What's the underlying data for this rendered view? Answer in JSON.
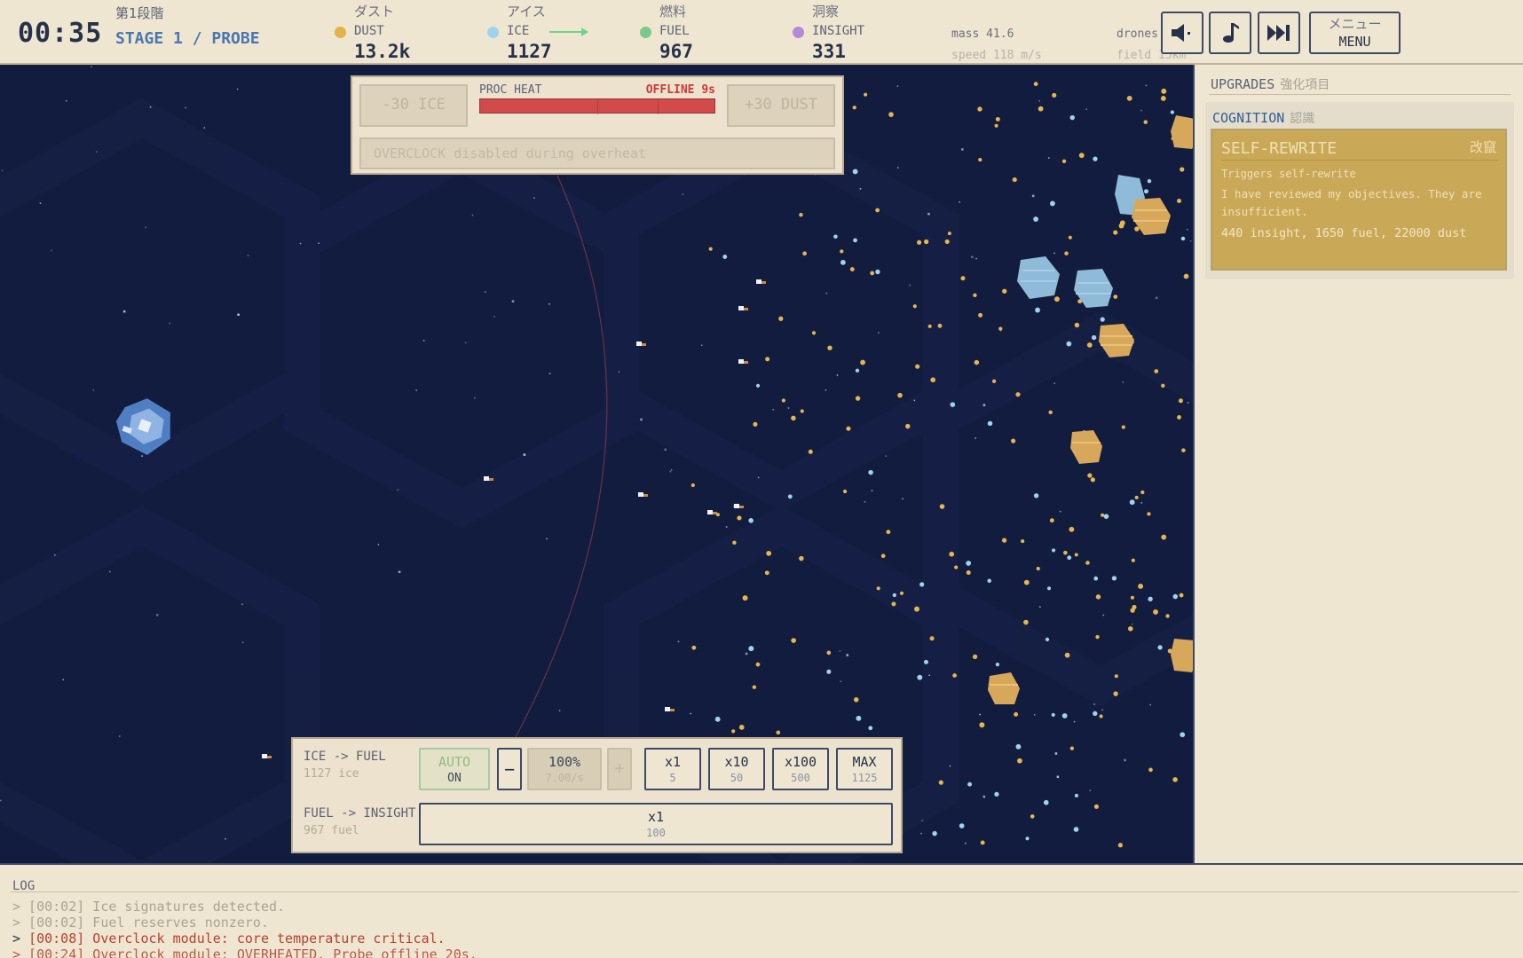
{
  "topbar": {
    "timer": "00:35",
    "stage_jp": "第1段階",
    "stage_label": "STAGE 1 / PROBE",
    "resources": [
      {
        "jp": "ダスト",
        "name": "DUST",
        "value": "13.2k",
        "color": "#e3b24a"
      },
      {
        "jp": "アイス",
        "name": "ICE",
        "value": "1127",
        "color": "#9fd2ec"
      },
      {
        "jp": "燃料",
        "name": "FUEL",
        "value": "967",
        "color": "#7cc88a"
      },
      {
        "jp": "洞察",
        "name": "INSIGHT",
        "value": "331",
        "color": "#b28ad6"
      }
    ],
    "mass": "mass 41.6",
    "speed": "speed 118 m/s",
    "drones": "drones",
    "field": "field 15km",
    "buttons": {
      "sound_icon": "speaker-icon",
      "music_icon": "music-note-icon",
      "skip_icon": "fast-forward-icon",
      "menu_jp": "メニュー",
      "menu_en": "MENU"
    }
  },
  "heat_panel": {
    "ice_button": "-30 ICE",
    "dust_button": "+30 DUST",
    "label": "PROC HEAT",
    "status": "OFFLINE 9s",
    "heat_level": 1.0,
    "overclock": "OVERCLOCK  disabled during overheat"
  },
  "conversion": {
    "row1_label": "ICE -> FUEL",
    "row1_sub": "1127 ice",
    "auto": {
      "label": "AUTO",
      "state": "ON"
    },
    "minus": "−",
    "percent": {
      "label": "100%",
      "rate": "7.00/s"
    },
    "plus": "+",
    "multipliers": [
      {
        "label": "x1",
        "cost": "5"
      },
      {
        "label": "x10",
        "cost": "50"
      },
      {
        "label": "x100",
        "cost": "500"
      },
      {
        "label": "MAX",
        "cost": "1125"
      }
    ],
    "row2_label": "FUEL -> INSIGHT",
    "row2_sub": "967 fuel",
    "row2_button": {
      "label": "x1",
      "cost": "100"
    }
  },
  "upgrades": {
    "title": "UPGRADES",
    "title_jp": "強化項目",
    "category": "COGNITION",
    "category_jp": "認識",
    "card": {
      "title": "SELF-REWRITE",
      "title_jp": "改竄",
      "subtitle": "Triggers self-rewrite",
      "description": "I have reviewed my objectives. They are insufficient.",
      "cost": "440 insight, 1650 fuel, 22000 dust",
      "color": "#c9a958"
    }
  },
  "log": {
    "title": "LOG",
    "lines": [
      {
        "text": "> [00:02] Ice signatures detected.",
        "kind": "old"
      },
      {
        "text": "> [00:02] Fuel reserves nonzero.",
        "kind": "old"
      },
      {
        "text": "[00:08] Overclock module: core temperature critical.",
        "kind": "warn"
      },
      {
        "text": "> [00:24] Overclock module: OVERHEATED. Probe offline 20s.",
        "kind": "warn-faded"
      }
    ]
  }
}
